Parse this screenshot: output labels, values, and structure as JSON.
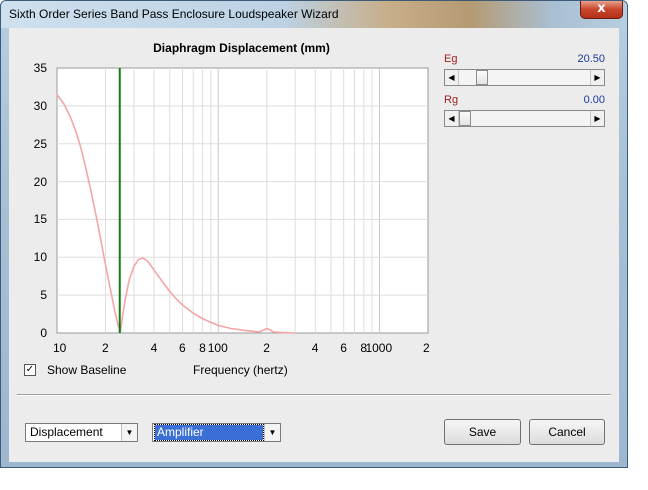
{
  "window": {
    "title": "Sixth Order Series Band Pass Enclosure Loudspeaker Wizard",
    "close_glyph": "x"
  },
  "chart": {
    "title": "Diaphragm Displacement (mm)",
    "y_ticks": [
      "35",
      "30",
      "25",
      "20",
      "15",
      "10",
      "5",
      "0"
    ],
    "x_ticks": [
      "10",
      "2",
      "4",
      "6",
      "8",
      "100",
      "2",
      "4",
      "6",
      "8",
      "1000",
      "2"
    ],
    "x_axis_label": "Frequency (hertz)"
  },
  "chart_data": {
    "type": "line",
    "title": "Diaphragm Displacement (mm)",
    "xlabel": "Frequency (hertz)",
    "ylabel": "",
    "x_scale": "log",
    "xlim": [
      10,
      2000
    ],
    "ylim": [
      0,
      35
    ],
    "grid": true,
    "series": [
      {
        "color": "#f4a6a6",
        "x": [
          10,
          11,
          12,
          13,
          14,
          15,
          16,
          17,
          18,
          19,
          20,
          21,
          22,
          23,
          24,
          24.8,
          25.5,
          26.5,
          28,
          30,
          32,
          34,
          36,
          38,
          40,
          45,
          50,
          55,
          60,
          70,
          80,
          90,
          100,
          120,
          150,
          180,
          200,
          210,
          220,
          250,
          300
        ],
        "y": [
          31.5,
          30.3,
          28.7,
          26.8,
          24.6,
          22.0,
          19.4,
          16.7,
          14.1,
          11.5,
          9.0,
          6.7,
          4.6,
          2.6,
          0.9,
          0.3,
          2.2,
          4.4,
          7.0,
          8.8,
          9.7,
          9.9,
          9.6,
          9.0,
          8.3,
          6.8,
          5.5,
          4.5,
          3.7,
          2.6,
          1.9,
          1.4,
          1.0,
          0.6,
          0.3,
          0.15,
          0.6,
          0.4,
          0.15,
          0.05,
          0.0
        ]
      }
    ],
    "markers": [
      {
        "type": "vertical_line",
        "x": 24.5,
        "color": "#127b12"
      }
    ]
  },
  "baseline": {
    "checked": true,
    "check_glyph": "✓",
    "label": "Show Baseline"
  },
  "sliders": [
    {
      "label": "Eg",
      "value": "20.50",
      "position": 0.14
    },
    {
      "label": "Rg",
      "value": "0.00",
      "position": 0.0
    }
  ],
  "controls": {
    "left_arrow": "◀",
    "right_arrow": "▶",
    "dropdown_arrow": "▼",
    "combo_display": "Displacement",
    "combo_source": "Amplifier",
    "save_label": "Save",
    "cancel_label": "Cancel"
  }
}
